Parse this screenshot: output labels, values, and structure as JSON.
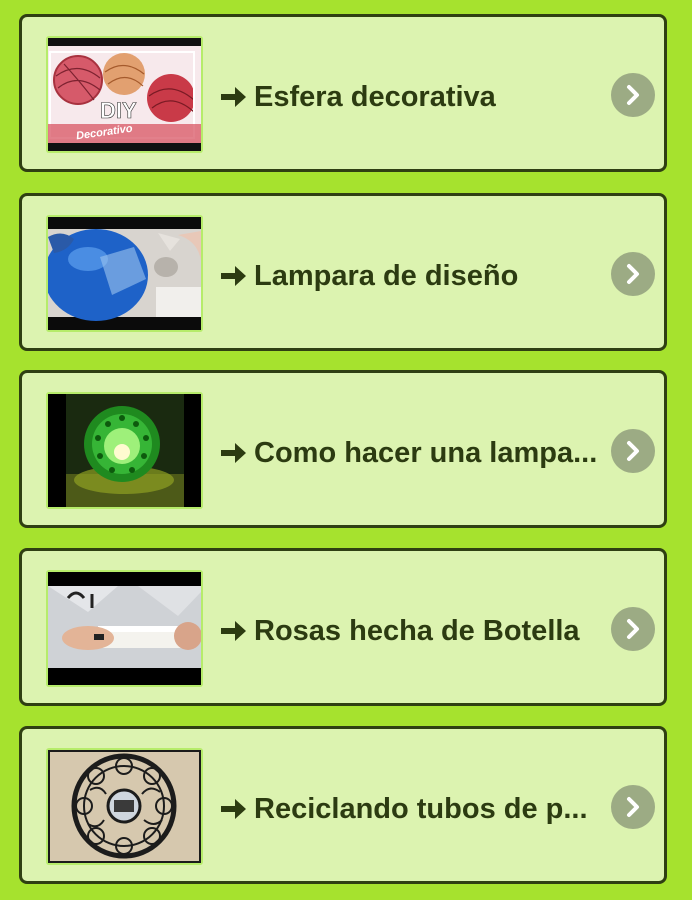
{
  "items": [
    {
      "title": "Esfera decorativa",
      "thumbnail_icon": "yarn-spheres-thumbnail",
      "thumbnail_text_1": "DIY",
      "thumbnail_text_2": "Decorativo"
    },
    {
      "title": "Lampara de diseño",
      "thumbnail_icon": "blue-balloon-thumbnail"
    },
    {
      "title": "Como hacer una lampa...",
      "thumbnail_icon": "green-lamp-thumbnail"
    },
    {
      "title": "Rosas hecha de Botella",
      "thumbnail_icon": "bottle-roses-thumbnail"
    },
    {
      "title": "Reciclando tubos de p...",
      "thumbnail_icon": "paper-tube-mirror-thumbnail"
    }
  ],
  "colors": {
    "background": "#a6e22e",
    "card": "#dcf3b0",
    "card_border": "#2f3f12",
    "text": "#2c3b11",
    "chevron_circle": "#9cab84"
  }
}
